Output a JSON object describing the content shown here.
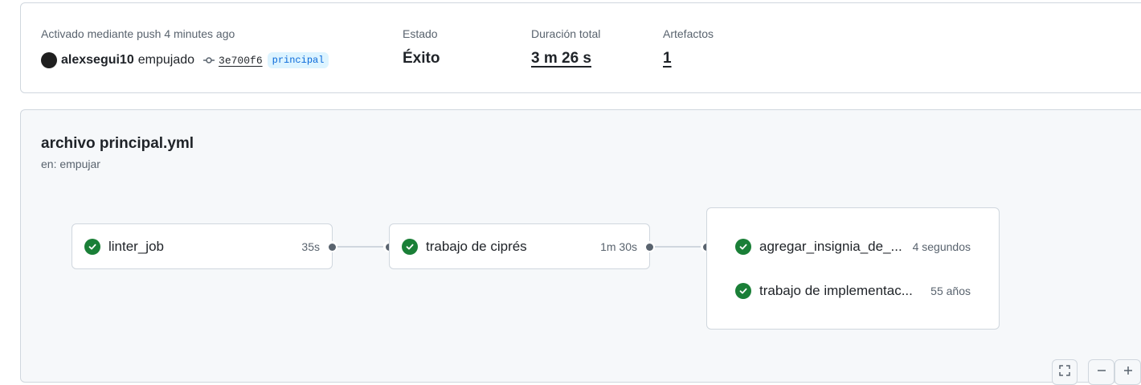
{
  "summary": {
    "trigger_label": "Activado mediante push 4 minutes ago",
    "user": "alexsegui10",
    "verb": "empujado",
    "commit_sha": "3e700f6",
    "branch": "principal",
    "status_label": "Estado",
    "status_value": "Éxito",
    "duration_label": "Duración total",
    "duration_value": "3 m 26 s",
    "artifacts_label": "Artefactos",
    "artifacts_value": "1"
  },
  "workflow": {
    "title": "archivo principal.yml",
    "subtitle": "en: empujar",
    "jobs": [
      {
        "name": "linter_job",
        "time": "35s",
        "status": "success"
      },
      {
        "name": "trabajo de ciprés",
        "time": "1m 30s",
        "status": "success"
      },
      {
        "name": "agregar_insignia_de_...",
        "time": "4 segundos",
        "status": "success"
      },
      {
        "name": "trabajo de implementac...",
        "time": "55 años",
        "status": "success"
      }
    ]
  },
  "controls": {
    "fullscreen_icon": "fullscreen-icon",
    "zoom_out_icon": "minus-icon",
    "zoom_in_icon": "plus-icon"
  },
  "colors": {
    "success": "#1a7f37",
    "link": "#0969da",
    "branch_bg": "#ddf4ff"
  }
}
